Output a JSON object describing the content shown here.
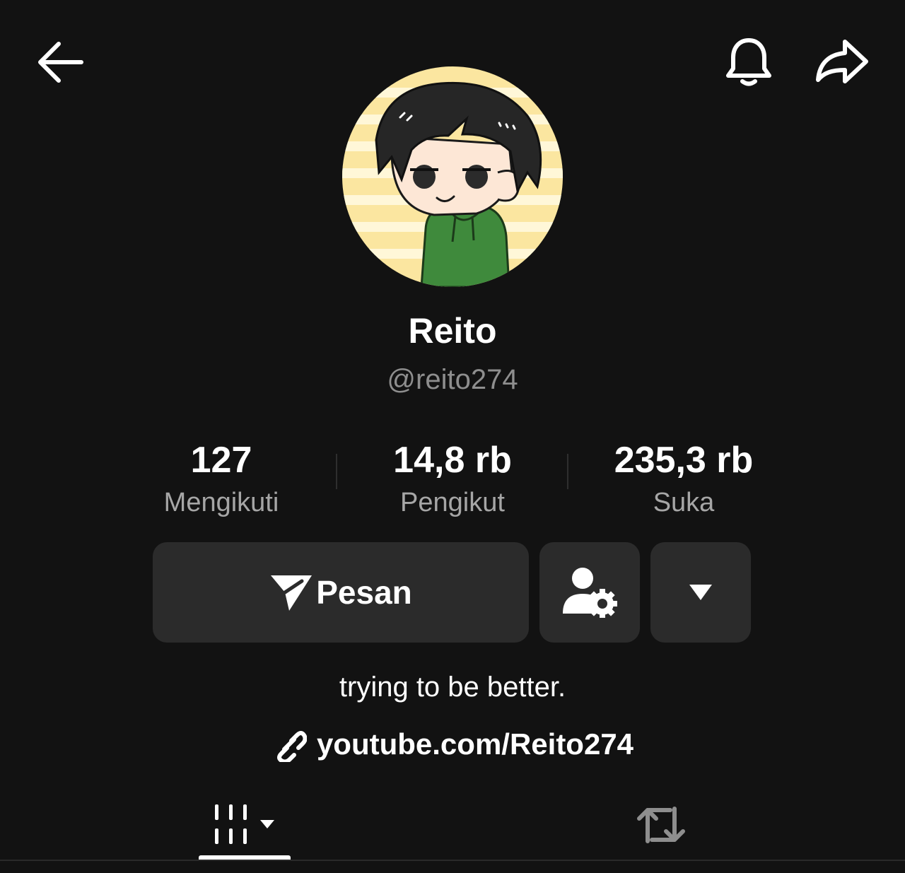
{
  "header": {
    "back_icon": "arrow-left-icon",
    "bell_icon": "bell-icon",
    "share_icon": "share-arrow-icon"
  },
  "profile": {
    "display_name": "Reito",
    "username": "@reito274",
    "avatar_icon": "anime-boy-avatar"
  },
  "stats": [
    {
      "value": "127",
      "label": "Mengikuti"
    },
    {
      "value": "14,8 rb",
      "label": "Pengikut"
    },
    {
      "value": "235,3 rb",
      "label": "Suka"
    }
  ],
  "actions": {
    "message_label": "Pesan",
    "message_icon": "send-paper-plane-icon",
    "friend_settings_icon": "user-gear-icon",
    "more_icon": "caret-down-icon"
  },
  "bio": "trying to be better.",
  "link": {
    "text": "youtube.com/Reito274",
    "icon": "link-icon"
  },
  "tabs": [
    {
      "name": "videos",
      "icon": "grid-bars-icon",
      "active": true
    },
    {
      "name": "reposts",
      "icon": "repost-icon",
      "active": false
    }
  ],
  "colors": {
    "background": "#121212",
    "button_bg": "#2b2b2b",
    "secondary_text": "#8e8e8e",
    "avatar_bg": "#fbe6a0",
    "hoodie": "#3f8a3c"
  }
}
